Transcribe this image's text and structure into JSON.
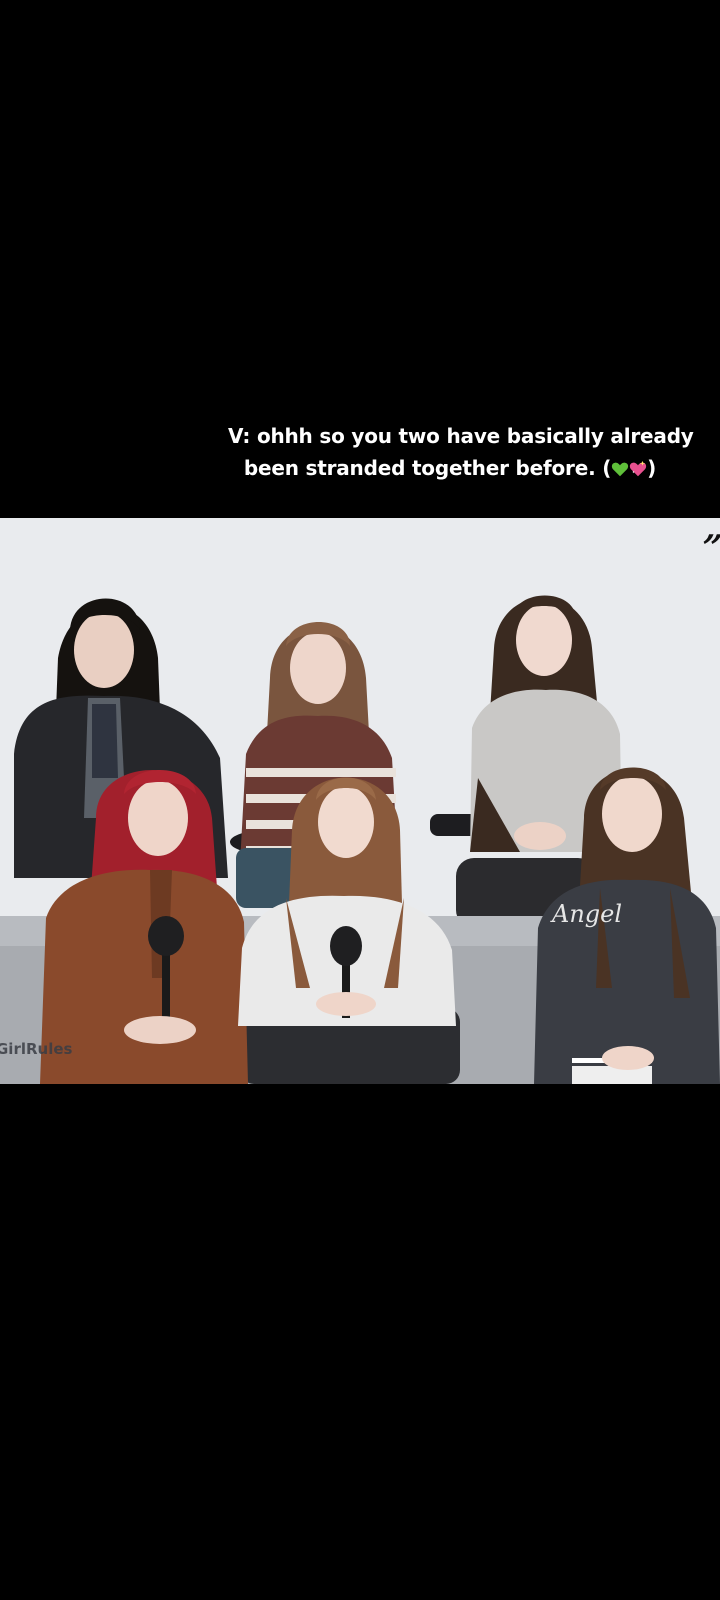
{
  "caption": {
    "line1": "V: ohhh so you two have basically already",
    "line2_prefix": "been stranded together before. (",
    "line2_suffix": ")",
    "emoji_1": "green-heart-icon",
    "emoji_2": "sparkling-heart-icon"
  },
  "video": {
    "watermark": "GirlRules",
    "corner_mark": "”",
    "shirt_text": "Angel"
  },
  "colors": {
    "background": "#000000",
    "caption_text": "#ffffff",
    "wall": "#e9ebee",
    "sofa": "#9fa2a8",
    "green_heart": "#5fbf3a",
    "pink_heart": "#e8508f"
  }
}
